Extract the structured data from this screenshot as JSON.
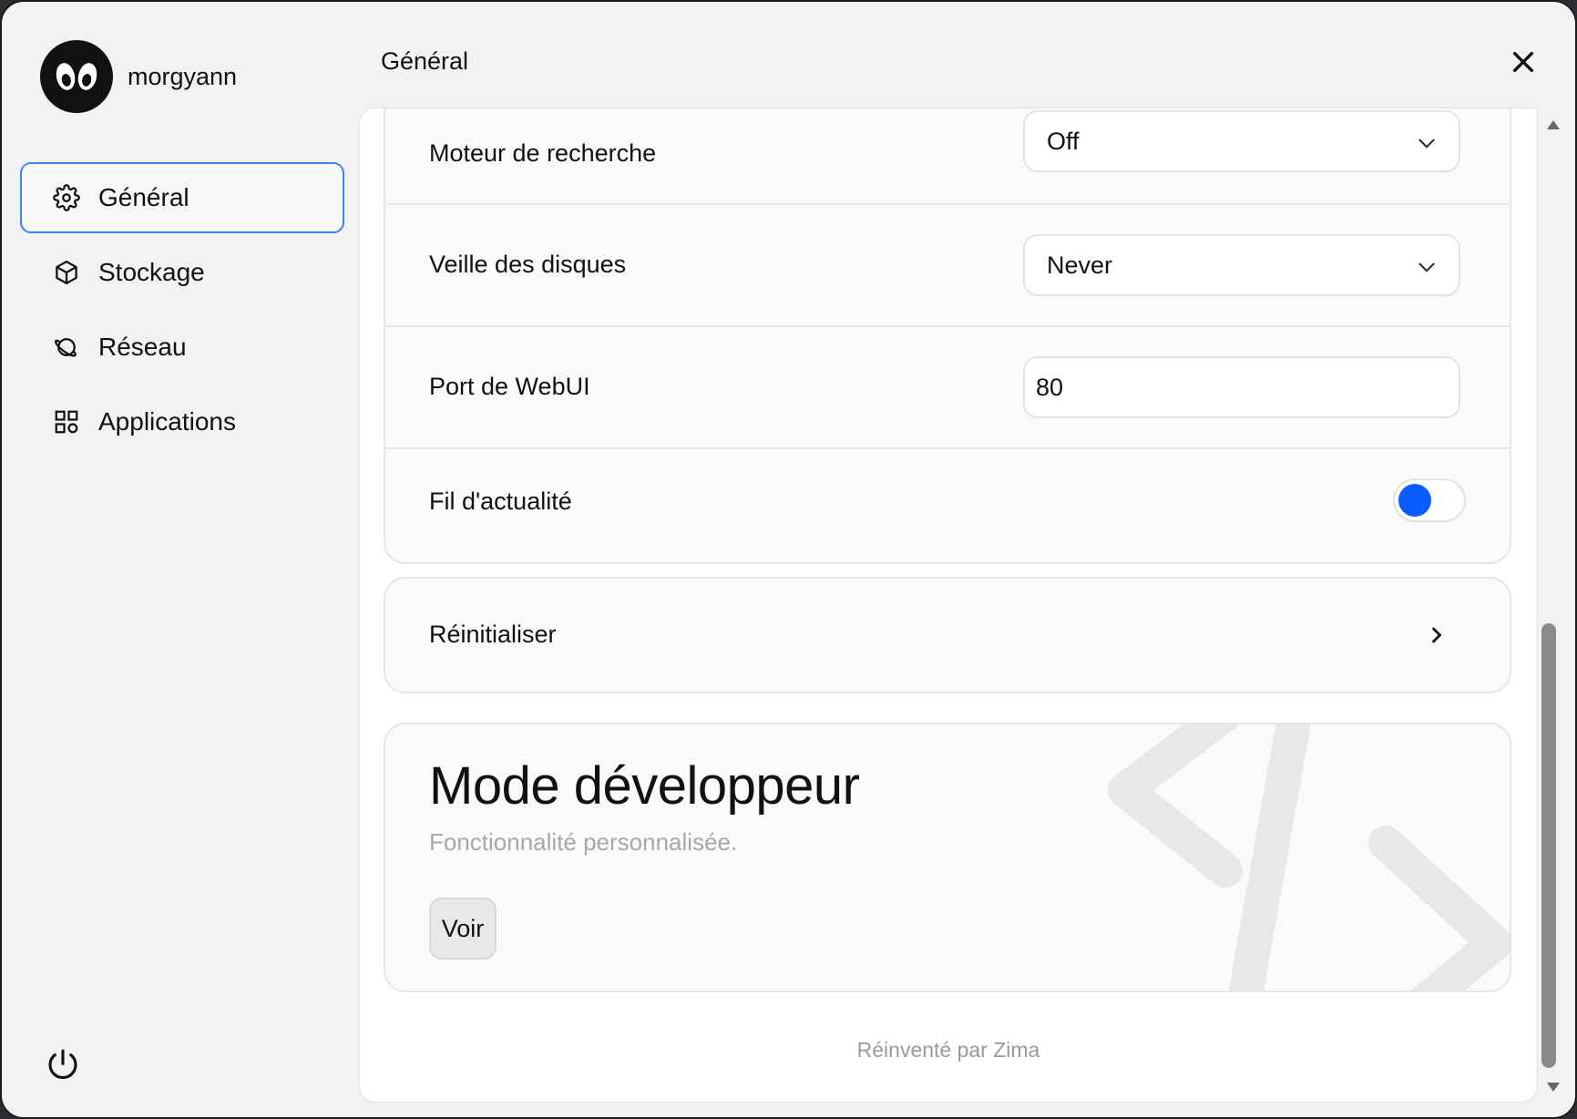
{
  "sidebar": {
    "username": "morgyann",
    "items": [
      {
        "label": "Général",
        "icon": "gear-icon",
        "active": true
      },
      {
        "label": "Stockage",
        "icon": "cube-icon",
        "active": false
      },
      {
        "label": "Réseau",
        "icon": "planet-icon",
        "active": false
      },
      {
        "label": "Applications",
        "icon": "grid-icon",
        "active": false
      }
    ]
  },
  "header": {
    "title": "Général"
  },
  "settings": {
    "search_engine": {
      "label": "Moteur de recherche",
      "value": "Off"
    },
    "disk_sleep": {
      "label": "Veille des disques",
      "value": "Never"
    },
    "webui_port": {
      "label": "Port de WebUI",
      "value": "80"
    },
    "news_feed": {
      "label": "Fil d'actualité",
      "enabled": true
    }
  },
  "reset": {
    "label": "Réinitialiser"
  },
  "developer": {
    "title": "Mode développeur",
    "subtitle": "Fonctionnalité personnalisée.",
    "button": "Voir"
  },
  "footer": "Réinventé par Zima",
  "colors": {
    "accent": "#0a5cff",
    "active_border": "#3b82f6"
  }
}
